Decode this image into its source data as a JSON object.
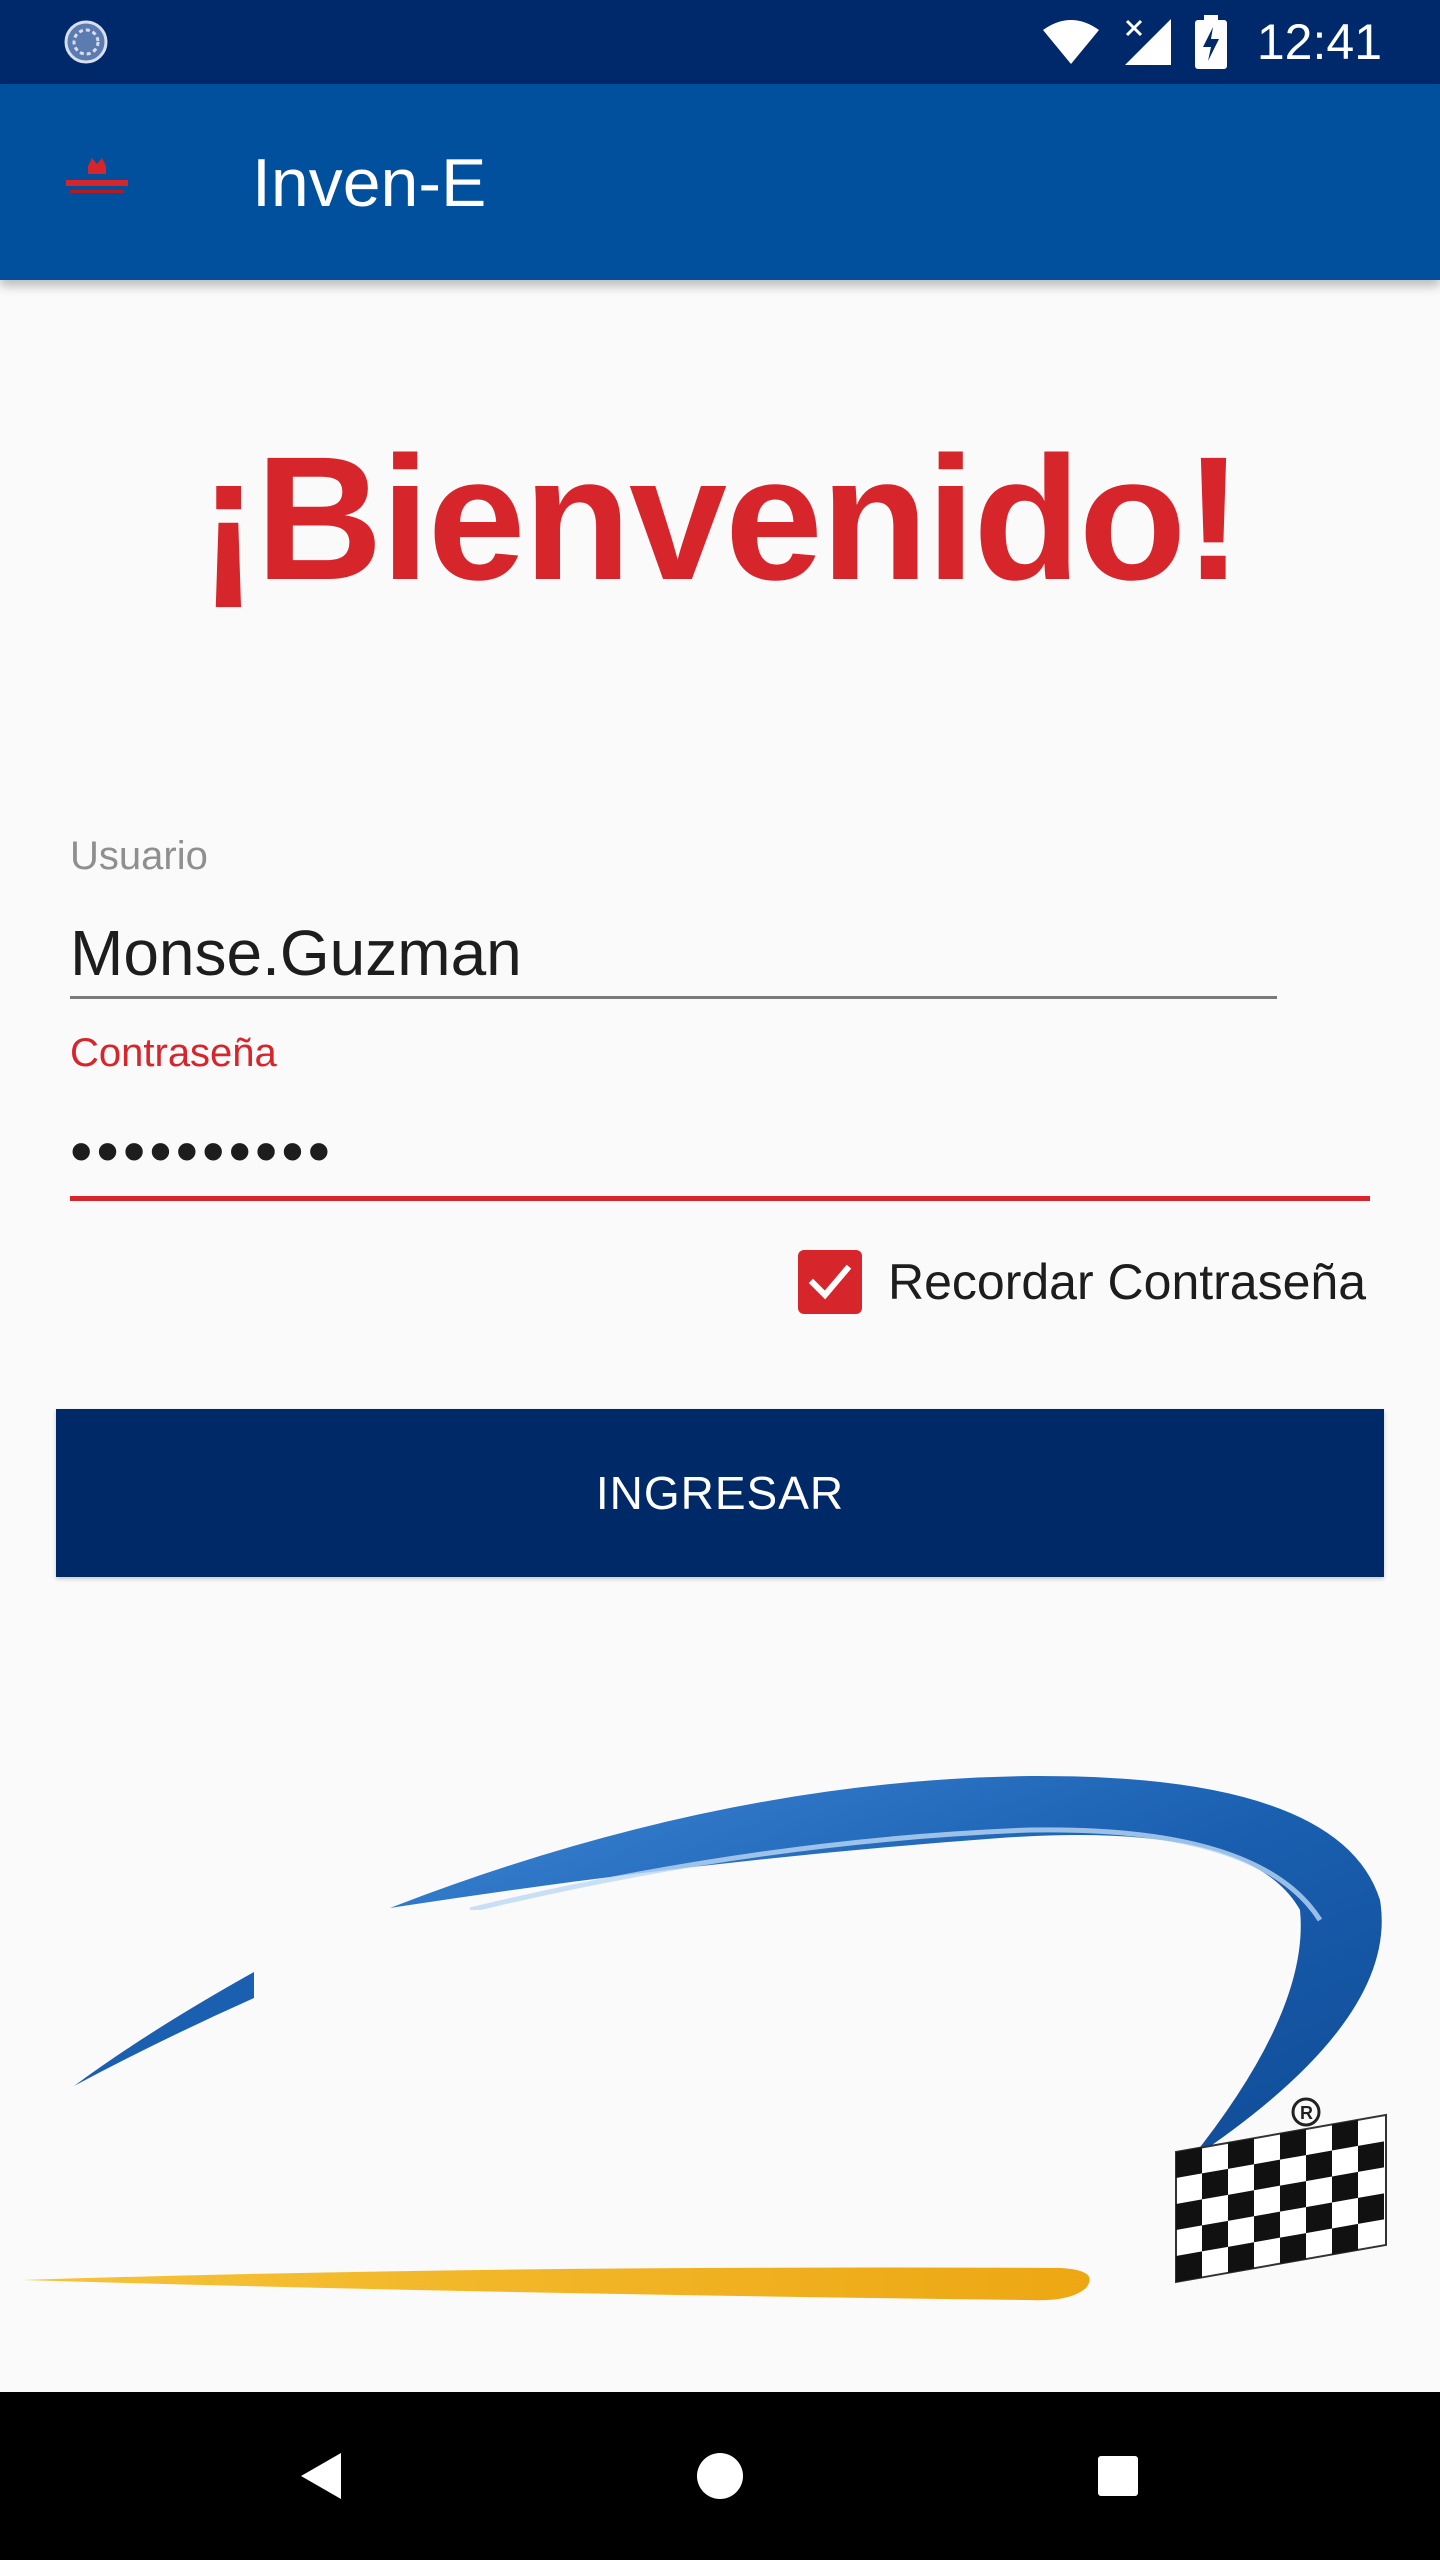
{
  "status_bar": {
    "time": "12:41",
    "icons": [
      "sync-icon",
      "wifi-icon",
      "signal-icon",
      "battery-charging-icon"
    ]
  },
  "app_bar": {
    "title": "Inven-E",
    "logo_icon": "brand-logo-icon"
  },
  "welcome": {
    "text": "¡Bienvenido!"
  },
  "form": {
    "username": {
      "label": "Usuario",
      "value": "Monse.Guzman"
    },
    "password": {
      "label": "Contraseña",
      "value": "••••••••••"
    },
    "remember": {
      "label": "Recordar Contraseña",
      "checked": true
    },
    "submit_label": "INGRESAR"
  },
  "nav_bar": {
    "icons": [
      "back-icon",
      "home-icon",
      "recents-icon"
    ]
  },
  "colors": {
    "status_bar": "#00296b",
    "app_bar": "#00509e",
    "accent_red": "#d6262b",
    "button": "#002968",
    "swoosh_blue": "#1f6bb8",
    "swoosh_yellow": "#f2b418"
  }
}
